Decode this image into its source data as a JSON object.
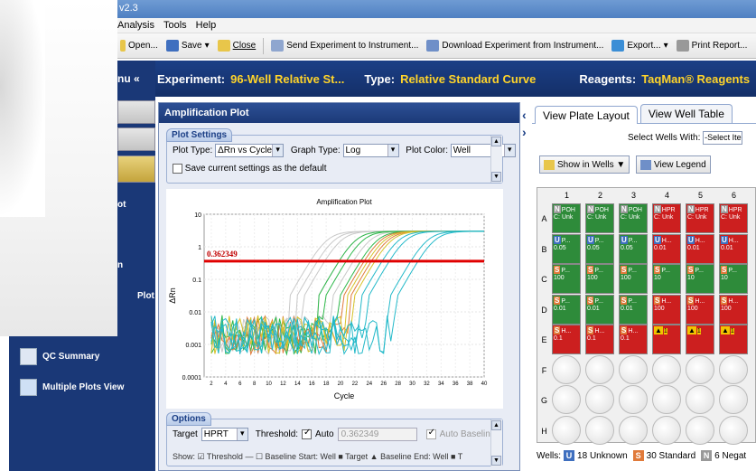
{
  "window": {
    "title": "v2.3"
  },
  "menu": [
    "Analysis",
    "Tools",
    "Help"
  ],
  "toolbar": {
    "open": "Open...",
    "save": "Save",
    "close": "Close",
    "send": "Send Experiment to Instrument...",
    "download": "Download Experiment from Instrument...",
    "export": "Export...",
    "print": "Print Report..."
  },
  "header": {
    "experiment_label": "Experiment:",
    "experiment": "96-Well Relative St...",
    "type_label": "Type:",
    "type": "Relative Standard Curve",
    "reagents_label": "Reagents:",
    "reagents": "TaqMan® Reagents"
  },
  "nav": {
    "menu_label": "nu «",
    "item_ot": "ot",
    "item_n": "n",
    "item_plot": "Plot",
    "qc": "QC Summary",
    "multiple": "Multiple Plots View"
  },
  "amp": {
    "panel_title": "Amplification Plot",
    "settings_label": "Plot Settings",
    "plot_type_label": "Plot Type:",
    "plot_type": "ΔRn vs Cycle",
    "graph_type_label": "Graph Type:",
    "graph_type": "Log",
    "plot_color_label": "Plot Color:",
    "plot_color": "Well",
    "save_default": "Save current settings as the default",
    "options_label": "Options",
    "target_label": "Target",
    "target": "HPRT",
    "threshold_label": "Threshold:",
    "auto_label": "Auto",
    "threshold_value": "0.362349",
    "auto_baseline": "Auto Baseline",
    "show_row": "Show: ☑ Threshold — ☐ Baseline Start: Well ■ Target ▲ Baseline End: Well ■ T"
  },
  "chart_data": {
    "type": "line",
    "title": "Amplification Plot",
    "xlabel": "Cycle",
    "ylabel": "ΔRn",
    "yscale": "log",
    "ylim": [
      0.0001,
      10
    ],
    "xlim": [
      1,
      40
    ],
    "x_ticks": [
      2,
      4,
      6,
      8,
      10,
      12,
      14,
      16,
      18,
      20,
      22,
      24,
      26,
      28,
      30,
      32,
      34,
      36,
      38,
      40
    ],
    "y_ticks": [
      "10",
      "1",
      "0.1",
      "0.01",
      "0.001",
      "0.0001"
    ],
    "threshold": 0.362349,
    "threshold_label": "0.362349",
    "curves": [
      {
        "color": "#c8c8c8",
        "ct": 18
      },
      {
        "color": "#c8c8c8",
        "ct": 19
      },
      {
        "color": "#c8c8c8",
        "ct": 20
      },
      {
        "color": "#c8c8c8",
        "ct": 22
      },
      {
        "color": "#c8c8c8",
        "ct": 24
      },
      {
        "color": "#2eb84a",
        "ct": 22
      },
      {
        "color": "#2eb84a",
        "ct": 23
      },
      {
        "color": "#2eb84a",
        "ct": 25
      },
      {
        "color": "#e07a3a",
        "ct": 25.5
      },
      {
        "color": "#e07a3a",
        "ct": 26.5
      },
      {
        "color": "#d6c22a",
        "ct": 26
      },
      {
        "color": "#d6c22a",
        "ct": 27
      },
      {
        "color": "#23b9c9",
        "ct": 28
      },
      {
        "color": "#23b9c9",
        "ct": 29
      },
      {
        "color": "#23b9c9",
        "ct": 32
      },
      {
        "color": "#23b9c9",
        "ct": 33
      }
    ]
  },
  "plate": {
    "tab_layout": "View Plate Layout",
    "tab_table": "View Well Table",
    "select_label": "Select Wells With:",
    "select_value": "-Select Iten",
    "show_wells": "Show in Wells ▼",
    "view_legend": "View Legend",
    "cols": [
      "1",
      "2",
      "3",
      "4",
      "5",
      "6"
    ],
    "rows": [
      "A",
      "B",
      "C",
      "D",
      "E",
      "F",
      "G",
      "H"
    ],
    "wells": [
      [
        {
          "t": "N",
          "v": "POH",
          "s": "C: Unk",
          "c": "#2e8b3a"
        },
        {
          "t": "N",
          "v": "POH",
          "s": "C: Unk",
          "c": "#2e8b3a"
        },
        {
          "t": "N",
          "v": "POH",
          "s": "C: Unk",
          "c": "#2e8b3a"
        },
        {
          "t": "N",
          "v": "HPR",
          "s": "C: Unk",
          "c": "#cc1f1f"
        },
        {
          "t": "N",
          "v": "HPR",
          "s": "C: Unk",
          "c": "#cc1f1f"
        },
        {
          "t": "N",
          "v": "HPR",
          "s": "C: Unk",
          "c": "#cc1f1f"
        }
      ],
      [
        {
          "t": "U",
          "v": "P...",
          "s": "0.05",
          "c": "#2e8b3a"
        },
        {
          "t": "U",
          "v": "P...",
          "s": "0.05",
          "c": "#2e8b3a"
        },
        {
          "t": "U",
          "v": "P...",
          "s": "0.05",
          "c": "#2e8b3a"
        },
        {
          "t": "U",
          "v": "H...",
          "s": "0.01",
          "c": "#cc1f1f"
        },
        {
          "t": "U",
          "v": "H...",
          "s": "0.01",
          "c": "#cc1f1f"
        },
        {
          "t": "U",
          "v": "H...",
          "s": "0.01",
          "c": "#cc1f1f"
        }
      ],
      [
        {
          "t": "S",
          "v": "P...",
          "s": "100",
          "c": "#2e8b3a"
        },
        {
          "t": "S",
          "v": "P...",
          "s": "100",
          "c": "#2e8b3a"
        },
        {
          "t": "S",
          "v": "P...",
          "s": "100",
          "c": "#2e8b3a"
        },
        {
          "t": "S",
          "v": "P...",
          "s": "10",
          "c": "#2e8b3a"
        },
        {
          "t": "S",
          "v": "P...",
          "s": "10",
          "c": "#2e8b3a"
        },
        {
          "t": "S",
          "v": "P...",
          "s": "10",
          "c": "#2e8b3a"
        }
      ],
      [
        {
          "t": "S",
          "v": "P...",
          "s": "0.01",
          "c": "#2e8b3a"
        },
        {
          "t": "S",
          "v": "P...",
          "s": "0.01",
          "c": "#2e8b3a"
        },
        {
          "t": "S",
          "v": "P...",
          "s": "0.01",
          "c": "#2e8b3a"
        },
        {
          "t": "S",
          "v": "H...",
          "s": "100",
          "c": "#cc1f1f"
        },
        {
          "t": "S",
          "v": "H...",
          "s": "100",
          "c": "#cc1f1f"
        },
        {
          "t": "S",
          "v": "H...",
          "s": "100",
          "c": "#cc1f1f"
        }
      ],
      [
        {
          "t": "S",
          "v": "H...",
          "s": "0.1",
          "c": "#cc1f1f"
        },
        {
          "t": "S",
          "v": "H...",
          "s": "0.1",
          "c": "#cc1f1f"
        },
        {
          "t": "S",
          "v": "H...",
          "s": "0.1",
          "c": "#cc1f1f"
        },
        {
          "t": "!",
          "v": "1",
          "s": "",
          "c": "#cc1f1f"
        },
        {
          "t": "!",
          "v": "1",
          "s": "",
          "c": "#cc1f1f"
        },
        {
          "t": "!",
          "v": "1",
          "s": "",
          "c": "#cc1f1f"
        }
      ]
    ],
    "footer_label": "Wells:",
    "unknown": "18 Unknown",
    "standard": "30 Standard",
    "negative": "6 Negat"
  }
}
